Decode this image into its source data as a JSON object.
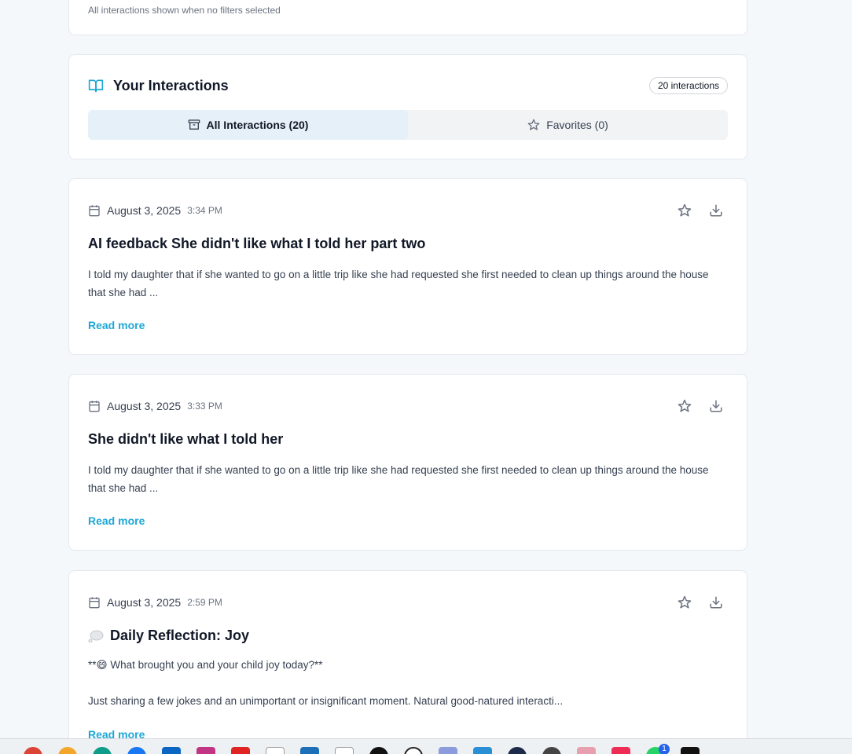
{
  "filter_card": {
    "note": "All interactions shown when no filters selected"
  },
  "interactions_header": {
    "icon": "book-open-icon",
    "title": "Your Interactions",
    "count_badge": "20 interactions",
    "tabs": [
      {
        "label": "All Interactions (20)",
        "icon": "archive-icon",
        "active": true
      },
      {
        "label": "Favorites (0)",
        "icon": "star-icon",
        "active": false
      }
    ]
  },
  "interactions": [
    {
      "date": "August 3, 2025",
      "time": "3:34 PM",
      "title": "AI feedback She didn't like what I told her part two",
      "body": "I told my daughter that if she wanted to go on a little trip like she had requested she first needed to clean up things around the house that she had ...",
      "read_more": "Read more"
    },
    {
      "date": "August 3, 2025",
      "time": "3:33 PM",
      "title": "She didn't like what I told her",
      "body": "I told my daughter that if she wanted to go on a little trip like she had requested she first needed to clean up things around the house that she had ...",
      "read_more": "Read more"
    },
    {
      "date": "August 3, 2025",
      "time": "2:59 PM",
      "title_emoji": "thought-balloon-icon",
      "title": "Daily Reflection: Joy",
      "body_line1": "**😄 What brought you and your child joy today?**",
      "body_line2": "Just sharing a few jokes and an unimportant or insignificant moment. Natural good-natured interacti...",
      "read_more": "Read more"
    }
  ],
  "colors": {
    "accent": "#1ea7d6",
    "active_tab_bg": "#e6f0f8",
    "page_bg": "#f5f8fa"
  },
  "taskbar": {
    "notification_badge": "1"
  }
}
